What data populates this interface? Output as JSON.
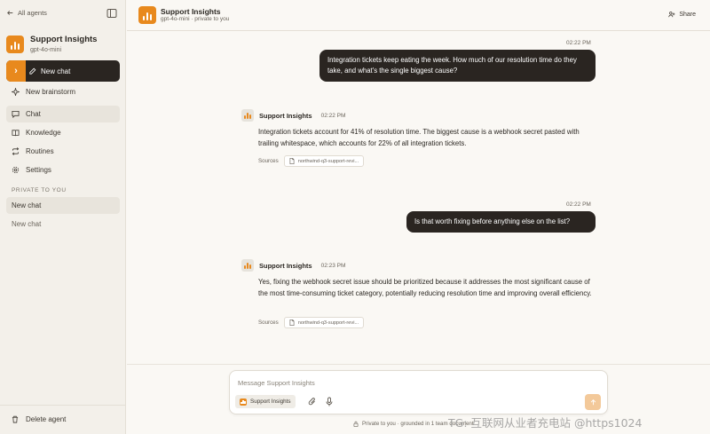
{
  "sidebar": {
    "back_label": "All agents",
    "agent": {
      "name": "Support Insights",
      "model": "gpt-4o-mini"
    },
    "new_chat_label": "New chat",
    "nav": [
      {
        "label": "New brainstorm",
        "icon": "sparkle-icon"
      },
      {
        "label": "Chat",
        "icon": "chat-bubble-icon",
        "active": true
      },
      {
        "label": "Knowledge",
        "icon": "book-icon"
      },
      {
        "label": "Routines",
        "icon": "repeat-icon"
      },
      {
        "label": "Settings",
        "icon": "gear-icon"
      }
    ],
    "section_label": "PRIVATE TO YOU",
    "chats": [
      {
        "label": "New chat",
        "active": true
      },
      {
        "label": "New chat",
        "active": false
      }
    ],
    "delete_label": "Delete agent"
  },
  "header": {
    "title": "Support Insights",
    "subtitle": "gpt-4o-mini · private to you",
    "share_label": "Share"
  },
  "messages": {
    "m1": {
      "time": "02:22 PM",
      "text": "Integration tickets keep eating the week. How much of our resolution time do they take, and what's the single biggest cause?"
    },
    "m2": {
      "name": "Support Insights",
      "time": "02:22 PM",
      "text": "Integration tickets account for 41% of resolution time. The biggest cause is a webhook secret pasted with trailing whitespace, which accounts for 22% of all integration tickets.",
      "sources_label": "Sources",
      "source": "northwind-q3-support-revi..."
    },
    "m3": {
      "time": "02:22 PM",
      "text": "Is that worth fixing before anything else on the list?"
    },
    "m4": {
      "name": "Support Insights",
      "time": "02:23 PM",
      "text": "Yes, fixing the webhook secret issue should be prioritized because it addresses the most significant cause of the most time-consuming ticket category, potentially reducing resolution time and improving overall efficiency.",
      "sources_label": "Sources",
      "source": "northwind-q3-support-revi..."
    }
  },
  "composer": {
    "placeholder": "Message Support Insights",
    "chip_label": "Support Insights",
    "footer": "Private to you · grounded in 1 team document"
  },
  "watermark": "TG: 互联网从业者充电站 @https1024",
  "colors": {
    "accent": "#e8891d",
    "dark": "#2a2521",
    "background": "#faf8f4",
    "sidebar": "#f3f0ea"
  }
}
